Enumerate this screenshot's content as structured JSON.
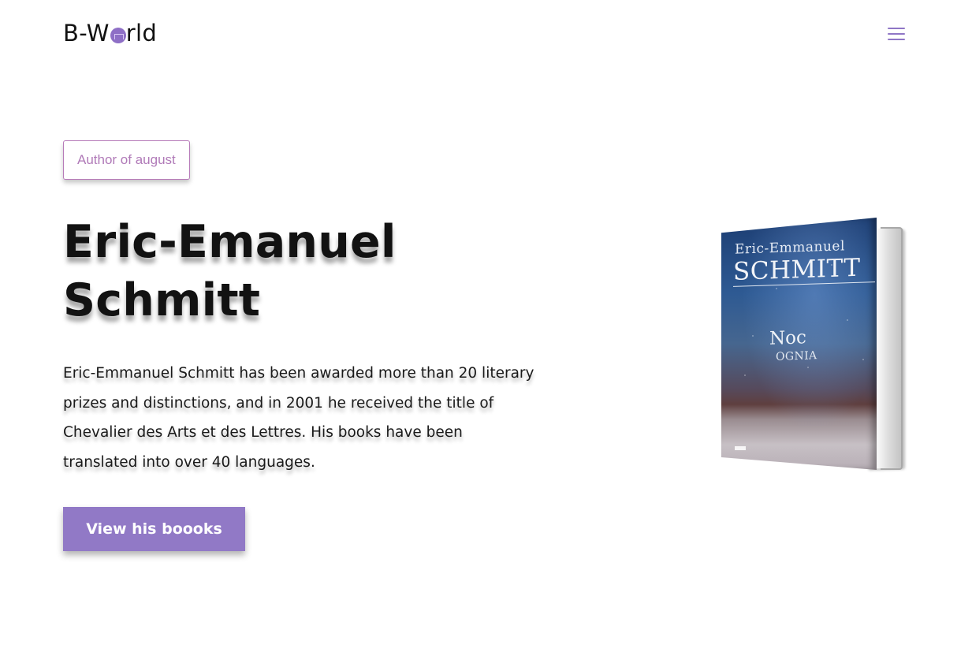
{
  "header": {
    "logo_prefix": "B-W",
    "logo_suffix": "rld",
    "menu_icon": "hamburger-menu-icon"
  },
  "hero": {
    "badge": "Author of august",
    "title": "Eric-Emanuel Schmitt",
    "description": "Eric-Emmanuel Schmitt has been awarded more than 20 literary prizes and distinctions, and in 2001 he received the title of Chevalier des Arts et des Lettres. His books have been translated into over 40 languages.",
    "cta_label": "View his boooks"
  },
  "book": {
    "author_first": "Eric-Emmanuel",
    "author_last": "SCHMITT",
    "title": "Noc",
    "subtitle": "OGNIA"
  },
  "colors": {
    "accent": "#9179c6",
    "badge_border": "#b77bb9",
    "text": "#111111"
  }
}
